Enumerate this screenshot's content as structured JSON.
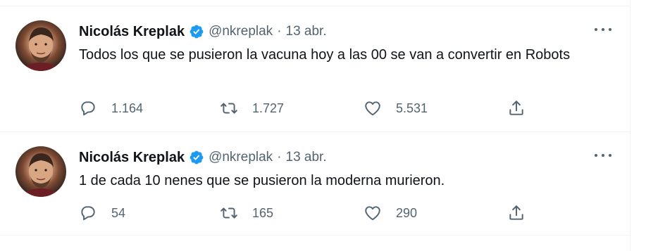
{
  "tweets": [
    {
      "author_name": "Nicolás Kreplak",
      "handle": "@nkreplak",
      "separator": "·",
      "date": "13 abr.",
      "text": "Todos los que se pusieron la vacuna hoy a las 00 se van a convertir en Robots",
      "replies": "1.164",
      "retweets": "1.727",
      "likes": "5.531"
    },
    {
      "author_name": "Nicolás Kreplak",
      "handle": "@nkreplak",
      "separator": "·",
      "date": "13 abr.",
      "text": "1 de cada 10 nenes que se pusieron la moderna murieron.",
      "replies": "54",
      "retweets": "165",
      "likes": "290"
    }
  ],
  "icons": {
    "verified": "verified-badge-icon",
    "more": "more-options-icon",
    "reply": "reply-icon",
    "retweet": "retweet-icon",
    "like": "heart-icon",
    "share": "share-icon"
  },
  "colors": {
    "verified": "#1d9bf0",
    "secondary_text": "#536471",
    "primary_text": "#0f1419",
    "divider": "#eff3f4"
  }
}
